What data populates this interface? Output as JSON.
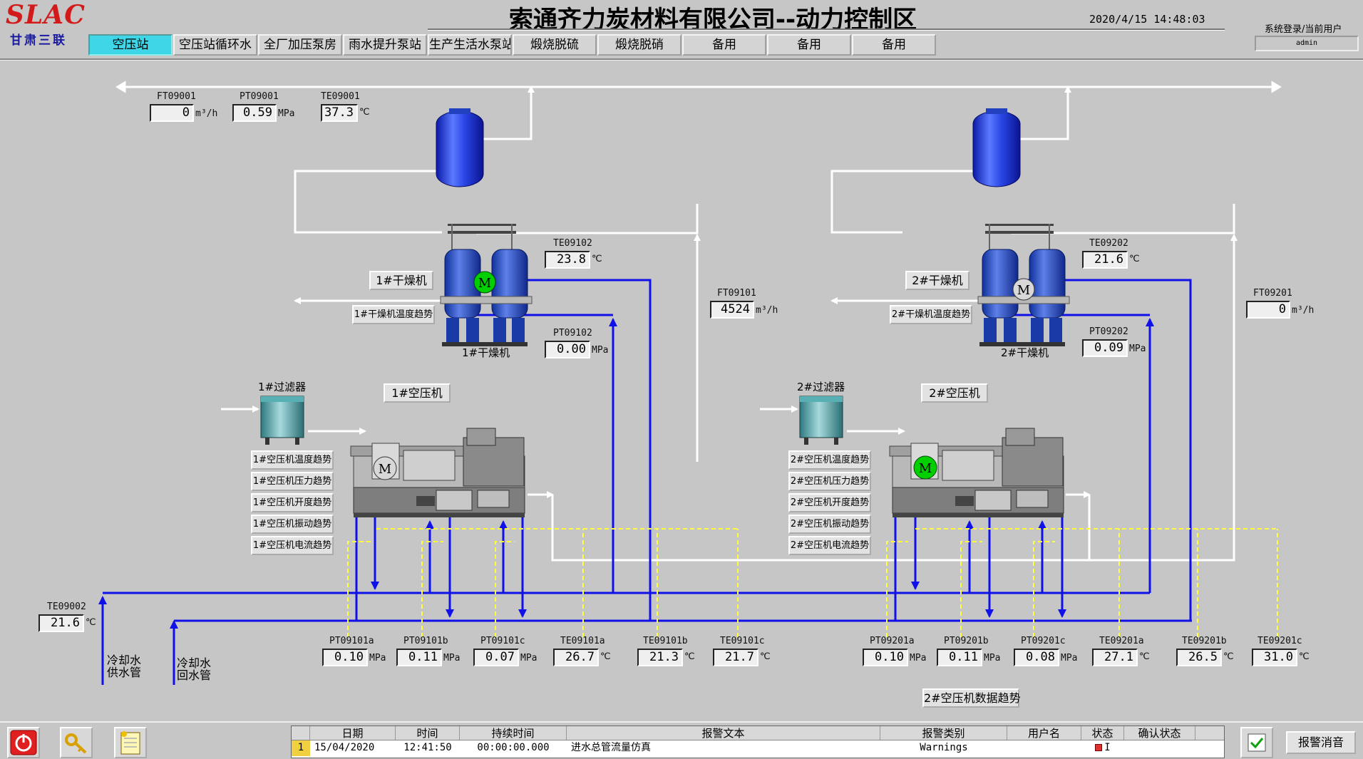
{
  "header": {
    "logo": "SLAC",
    "logo_sub": "甘肃三联",
    "title": "索通齐力炭材料有限公司--动力控制区",
    "datetime": "2020/4/15  14:48:03",
    "login_label": "系统登录/当前用户",
    "user": "admin",
    "tabs": [
      {
        "label": "空压站",
        "active": true
      },
      {
        "label": "空压站循环水",
        "active": false
      },
      {
        "label": "全厂加压泵房",
        "active": false
      },
      {
        "label": "雨水提升泵站",
        "active": false
      },
      {
        "label": "生产生活水泵站",
        "active": false
      },
      {
        "label": "煅烧脱硫",
        "active": false
      },
      {
        "label": "煅烧脱硝",
        "active": false
      },
      {
        "label": "备用",
        "active": false
      },
      {
        "label": "备用",
        "active": false
      },
      {
        "label": "备用",
        "active": false
      }
    ]
  },
  "colors": {
    "pipe_blue": "#1010e8",
    "pipe_white": "#ffffff",
    "signal_yellow": "#ffff3a",
    "motor_on": "#00d000",
    "motor_off": "#d8d8d8",
    "tank_blue": "#2040e0"
  },
  "top": {
    "FT09001": {
      "tag": "FT09001",
      "value": "0",
      "unit": "m³/h"
    },
    "PT09001": {
      "tag": "PT09001",
      "value": "0.59",
      "unit": "MPa"
    },
    "TE09001": {
      "tag": "TE09001",
      "value": "37.3",
      "unit": "℃"
    }
  },
  "dryer1": {
    "button": "1#干燥机",
    "trend": "1#干燥机温度趋势",
    "name_label": "1#干燥机",
    "motor": "M",
    "TE": {
      "tag": "TE09102",
      "value": "23.8",
      "unit": "℃"
    },
    "PT": {
      "tag": "PT09102",
      "value": "0.00",
      "unit": "MPa"
    }
  },
  "dryer2": {
    "button": "2#干燥机",
    "trend": "2#干燥机温度趋势",
    "name_label": "2#干燥机",
    "motor": "M",
    "TE": {
      "tag": "TE09202",
      "value": "21.6",
      "unit": "℃"
    },
    "PT": {
      "tag": "PT09202",
      "value": "0.09",
      "unit": "MPa"
    }
  },
  "FT09101": {
    "tag": "FT09101",
    "value": "4524",
    "unit": "m³/h"
  },
  "FT09201": {
    "tag": "FT09201",
    "value": "0",
    "unit": "m³/h"
  },
  "comp1": {
    "filter_label": "1#过滤器",
    "button": "1#空压机",
    "motor": "M",
    "trends": [
      "1#空压机温度趋势",
      "1#空压机压力趋势",
      "1#空压机开度趋势",
      "1#空压机振动趋势",
      "1#空压机电流趋势"
    ],
    "sensors": [
      {
        "tag": "PT09101a",
        "value": "0.10",
        "unit": "MPa"
      },
      {
        "tag": "PT09101b",
        "value": "0.11",
        "unit": "MPa"
      },
      {
        "tag": "PT09101c",
        "value": "0.07",
        "unit": "MPa"
      },
      {
        "tag": "TE09101a",
        "value": "26.7",
        "unit": "℃"
      },
      {
        "tag": "TE09101b",
        "value": "21.3",
        "unit": "℃"
      },
      {
        "tag": "TE09101c",
        "value": "21.7",
        "unit": "℃"
      }
    ]
  },
  "comp2": {
    "filter_label": "2#过滤器",
    "button": "2#空压机",
    "motor": "M",
    "trends": [
      "2#空压机温度趋势",
      "2#空压机压力趋势",
      "2#空压机开度趋势",
      "2#空压机振动趋势",
      "2#空压机电流趋势"
    ],
    "sensors": [
      {
        "tag": "PT09201a",
        "value": "0.10",
        "unit": "MPa"
      },
      {
        "tag": "PT09201b",
        "value": "0.11",
        "unit": "MPa"
      },
      {
        "tag": "PT09201c",
        "value": "0.08",
        "unit": "MPa"
      },
      {
        "tag": "TE09201a",
        "value": "27.1",
        "unit": "℃"
      },
      {
        "tag": "TE09201b",
        "value": "26.5",
        "unit": "℃"
      },
      {
        "tag": "TE09201c",
        "value": "31.0",
        "unit": "℃"
      }
    ],
    "data_trend": "2#空压机数据趋势"
  },
  "TE09002": {
    "tag": "TE09002",
    "value": "21.6",
    "unit": "℃"
  },
  "water": {
    "supply": "冷却水供水管",
    "return": "冷却水回水管"
  },
  "alarm": {
    "headers": [
      "日期",
      "时间",
      "持续时间",
      "报警文本",
      "报警类别",
      "用户名",
      "状态",
      "确认状态"
    ],
    "row": {
      "index": "1",
      "date": "15/04/2020",
      "time": "12:41:50",
      "duration": "00:00:00.000",
      "text": "进水总管流量仿真",
      "category": "Warnings",
      "user": "",
      "status": "I",
      "ack": ""
    },
    "silence": "报警消音"
  }
}
